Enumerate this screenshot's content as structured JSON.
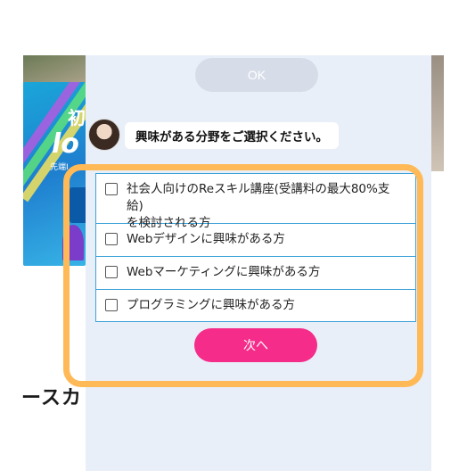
{
  "background": {
    "banner_line1": "初",
    "banner_line2": "lo",
    "banner_line3": "先端I",
    "section_heading": "ースカ"
  },
  "dialog": {
    "ok_label": "OK",
    "question": "興味がある分野をご選択ください。",
    "options": [
      {
        "label": "社会人向けのReスキル講座(受講料の最大80%支給)\nを検討される方",
        "checked": false
      },
      {
        "label": "Webデザインに興味がある方",
        "checked": false
      },
      {
        "label": "Webマーケティングに興味がある方",
        "checked": false
      },
      {
        "label": "プログラミングに興味がある方",
        "checked": false
      }
    ],
    "next_label": "次へ"
  },
  "colors": {
    "panel_bg": "#e9eff8",
    "next_button": "#f52c8a",
    "ok_button_disabled": "#d7dde8",
    "option_border": "#3ea3d8",
    "highlight": "#ffb957"
  }
}
